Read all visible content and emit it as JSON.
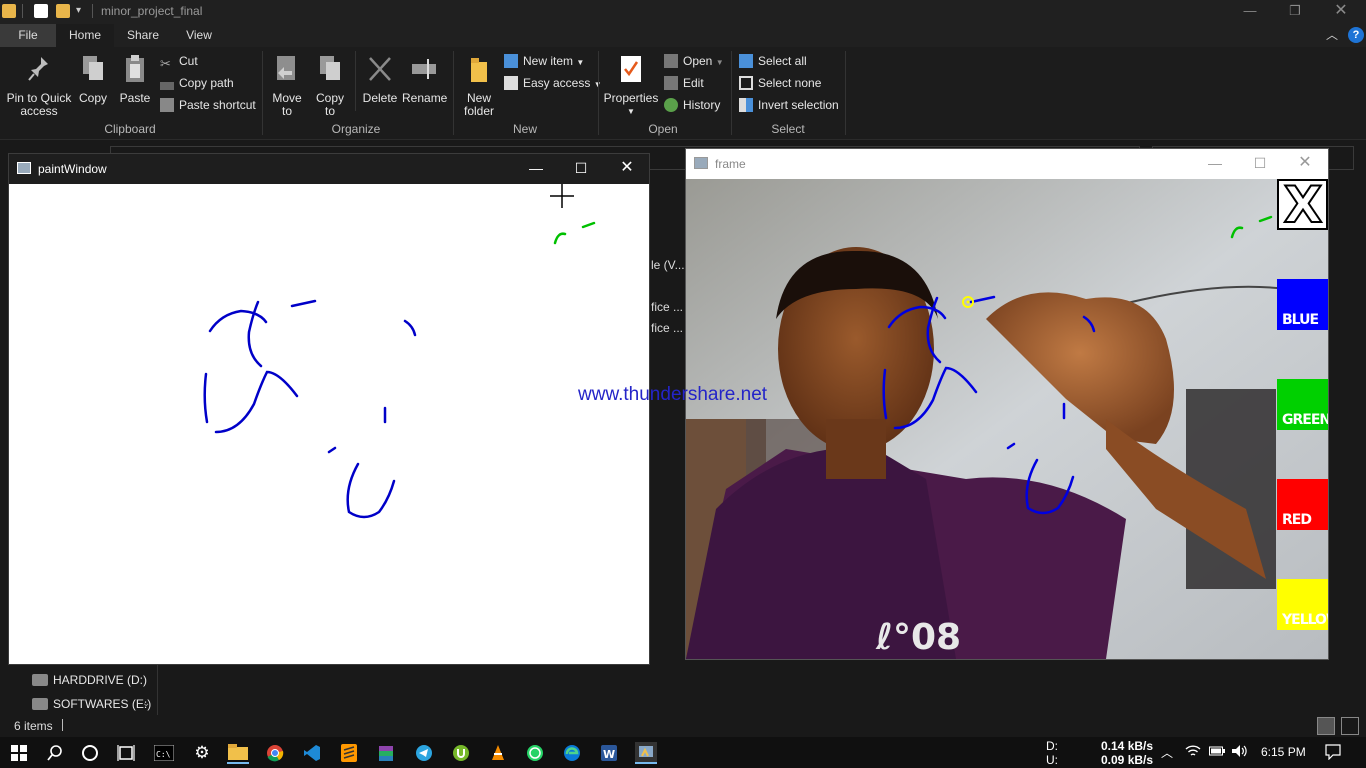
{
  "explorer": {
    "title": "minor_project_final",
    "tabs": [
      {
        "label": "File"
      },
      {
        "label": "Home"
      },
      {
        "label": "Share"
      },
      {
        "label": "View"
      }
    ],
    "ribbon": {
      "clipboard": {
        "pin_label_1": "Pin to Quick",
        "pin_label_2": "access",
        "copy": "Copy",
        "paste": "Paste",
        "cut": "Cut",
        "copy_path": "Copy path",
        "paste_shortcut": "Paste shortcut",
        "group": "Clipboard"
      },
      "organize": {
        "move_1": "Move",
        "move_2": "to",
        "copy_1": "Copy",
        "copy_2": "to",
        "delete": "Delete",
        "rename": "Rename",
        "group": "Organize"
      },
      "new": {
        "folder_1": "New",
        "folder_2": "folder",
        "new_item": "New item",
        "easy_access": "Easy access",
        "group": "New"
      },
      "open": {
        "properties": "Properties",
        "open": "Open",
        "edit": "Edit",
        "history": "History",
        "group": "Open"
      },
      "select": {
        "select_all": "Select all",
        "select_none": "Select none",
        "invert": "Invert selection",
        "group": "Select"
      }
    },
    "partial_items": [
      "le (V...",
      "fice ...",
      "fice ..."
    ],
    "drives": [
      {
        "label": "HARDDRIVE (D:)"
      },
      {
        "label": "SOFTWARES (E:)"
      }
    ],
    "status": "6 items"
  },
  "paint_window": {
    "title": "paintWindow"
  },
  "frame_window": {
    "title": "frame",
    "buttons": {
      "clear": "X",
      "blue": "BLUE",
      "green": "GREEN",
      "red": "RED",
      "yellow": "YELLOW"
    },
    "colors": {
      "blue": "#0000ff",
      "green": "#00d000",
      "red": "#ff0000",
      "yellow": "#ffff00"
    }
  },
  "watermark": "www.thundershare.net",
  "taskbar": {
    "net_d_label": "D:",
    "net_u_label": "U:",
    "net_d": "0.14 kB/s",
    "net_u": "0.09 kB/s",
    "time": "6:15 PM"
  }
}
